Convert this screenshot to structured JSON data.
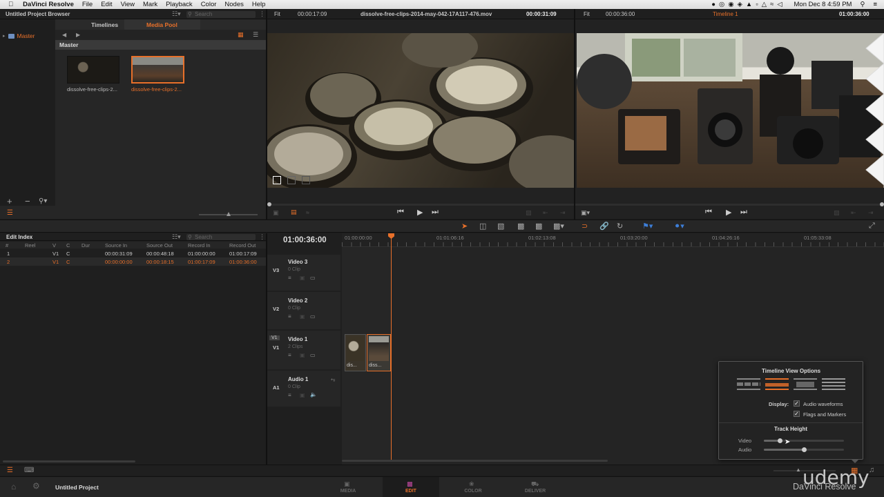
{
  "menubar": {
    "items": [
      "DaVinci Resolve",
      "File",
      "Edit",
      "View",
      "Mark",
      "Playback",
      "Color",
      "Nodes",
      "Help"
    ],
    "clock": "Mon Dec 8  4:59 PM"
  },
  "browser": {
    "title": "Untitled Project Browser",
    "search_placeholder": "Search",
    "tabs": [
      "Timelines",
      "Media Pool"
    ],
    "folder": "Master",
    "bin_title": "Master",
    "clips": [
      "dissolve-free-clips-2...",
      "dissolve-free-clips-2..."
    ]
  },
  "source_viewer": {
    "fit": "Fit",
    "duration": "00:00:17:09",
    "clip_name": "dissolve-free-clips-2014-may-042-17A117-476.mov",
    "timecode": "00:00:31:09"
  },
  "timeline_viewer": {
    "fit": "Fit",
    "duration": "00:00:36:00",
    "timeline_name": "Timeline 1",
    "timecode": "01:00:36:00"
  },
  "edit_index": {
    "title": "Edit Index",
    "search_placeholder": "Search",
    "columns": [
      "#",
      "Reel",
      "V",
      "C",
      "Dur",
      "Source In",
      "Source Out",
      "Record In",
      "Record Out"
    ],
    "rows": [
      {
        "num": "1",
        "reel": "",
        "v": "V1",
        "c": "C",
        "dur": "",
        "src_in": "00:00:31:09",
        "src_out": "00:00:48:18",
        "rec_in": "01:00:00:00",
        "rec_out": "01:00:17:09",
        "active": false
      },
      {
        "num": "2",
        "reel": "",
        "v": "V1",
        "c": "C",
        "dur": "",
        "src_in": "00:00:00:00",
        "src_out": "00:00:18:15",
        "rec_in": "01:00:17:09",
        "rec_out": "01:00:36:00",
        "active": true
      }
    ]
  },
  "timeline": {
    "timecode": "01:00:36:00",
    "ruler": [
      "01:00:00:00",
      "01:01:06:16",
      "01:02:13:08",
      "01:03:20:00",
      "01:04:26:16",
      "01:05:33:08"
    ],
    "tracks": [
      {
        "id": "V3",
        "name": "Video 3",
        "clips": "0 Clip"
      },
      {
        "id": "V2",
        "name": "Video 2",
        "clips": "0 Clip"
      },
      {
        "id": "V1",
        "name": "Video 1",
        "clips": "2 Clips"
      },
      {
        "id": "A1",
        "name": "Audio 1",
        "clips": "0 Clip"
      }
    ],
    "clip_labels": [
      "dis...",
      "diss..."
    ],
    "v1_patch": "V1"
  },
  "view_options": {
    "title": "Timeline View Options",
    "display_label": "Display:",
    "audio_waveforms": "Audio waveforms",
    "flags_markers": "Flags and Markers",
    "track_height": "Track Height",
    "video_label": "Video",
    "audio_label": "Audio",
    "video_level": 0.2,
    "audio_level": 0.5
  },
  "bottom": {
    "project": "Untitled Project",
    "pages": [
      "MEDIA",
      "EDIT",
      "COLOR",
      "DELIVER"
    ],
    "active_page": "EDIT",
    "watermark": "udemy",
    "brand": "DaVinci Resolve"
  }
}
